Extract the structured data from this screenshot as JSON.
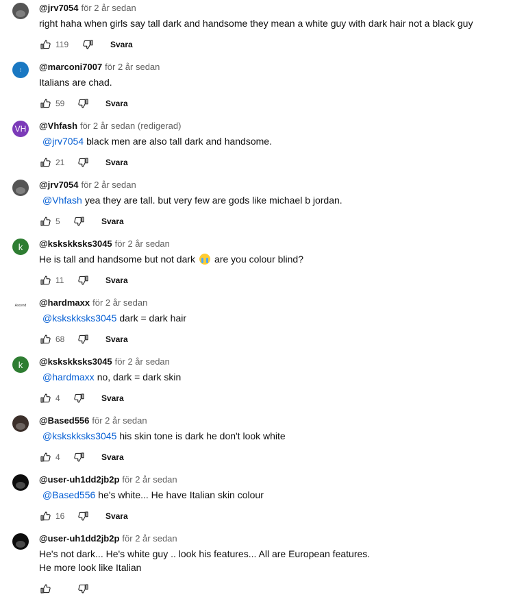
{
  "comments": [
    {
      "handle": "@jrv7054",
      "meta": "för 2 år sedan",
      "mention": "",
      "text": "right haha when girls say tall dark and handsome they mean a white guy with dark hair not a black guy",
      "likes": "119",
      "reply_label": "Svara",
      "avatar": {
        "type": "photo",
        "letters": "",
        "color": "#555555"
      }
    },
    {
      "handle": "@marconi7007",
      "meta": "för 2 år sedan",
      "mention": "",
      "text": "Italians are chad.",
      "likes": "59",
      "reply_label": "Svara",
      "avatar": {
        "type": "blue",
        "letters": "",
        "color": "#1a78c2"
      }
    },
    {
      "handle": "@Vhfash",
      "meta": "för 2 år sedan (redigerad)",
      "mention": "@jrv7054",
      "text": "black men are also tall dark and handsome.",
      "likes": "21",
      "reply_label": "Svara",
      "avatar": {
        "type": "letters",
        "letters": "VH",
        "color": "#7b3ab8"
      }
    },
    {
      "handle": "@jrv7054",
      "meta": "för 2 år sedan",
      "mention": "@Vhfash",
      "text": "yea they are tall. but very few are gods like michael b jordan.",
      "likes": "5",
      "reply_label": "Svara",
      "avatar": {
        "type": "photo",
        "letters": "",
        "color": "#555555"
      }
    },
    {
      "handle": "@kskskksks3045",
      "meta": "för 2 år sedan",
      "mention": "",
      "text": "He is tall and handsome but not dark",
      "text_after": "are you colour blind?",
      "likes": "11",
      "reply_label": "Svara",
      "avatar": {
        "type": "letters",
        "letters": "k",
        "color": "#2e7d32"
      }
    },
    {
      "handle": "@hardmaxx",
      "meta": "för 2 år sedan",
      "mention": "@kskskksks3045",
      "text": "dark = dark hair",
      "likes": "68",
      "reply_label": "Svara",
      "avatar": {
        "type": "logo",
        "letters": "Ascend",
        "color": "#ffffff"
      }
    },
    {
      "handle": "@kskskksks3045",
      "meta": "för 2 år sedan",
      "mention": "@hardmaxx",
      "text": "no, dark = dark skin",
      "likes": "4",
      "reply_label": "Svara",
      "avatar": {
        "type": "letters",
        "letters": "k",
        "color": "#2e7d32"
      }
    },
    {
      "handle": "@Based556",
      "meta": "för 2 år sedan",
      "mention": "@kskskksks3045",
      "text": "his skin tone is dark he don't look white",
      "likes": "4",
      "reply_label": "Svara",
      "avatar": {
        "type": "photo",
        "letters": "",
        "color": "#3b2f2a"
      }
    },
    {
      "handle": "@user-uh1dd2jb2p",
      "meta": "för 2 år sedan",
      "mention": "@Based556",
      "text": "he's white... He have  Italian skin colour",
      "likes": "16",
      "reply_label": "Svara",
      "avatar": {
        "type": "photo",
        "letters": "",
        "color": "#0d0d0d"
      }
    },
    {
      "handle": "@user-uh1dd2jb2p",
      "meta": "för 2 år sedan",
      "mention": "",
      "text": "He's not dark... He's white guy .. look his features... All are European features.",
      "text_line2": "He more look like Italian",
      "likes": "",
      "reply_label": "",
      "avatar": {
        "type": "photo",
        "letters": "",
        "color": "#0d0d0d"
      }
    }
  ],
  "colors": {
    "link": "#065fd4",
    "meta": "#606060",
    "text": "#0f0f0f"
  },
  "icons": {
    "like": "thumb-up-icon",
    "dislike": "thumb-down-icon",
    "emoji": "loudly-crying-face-emoji"
  }
}
